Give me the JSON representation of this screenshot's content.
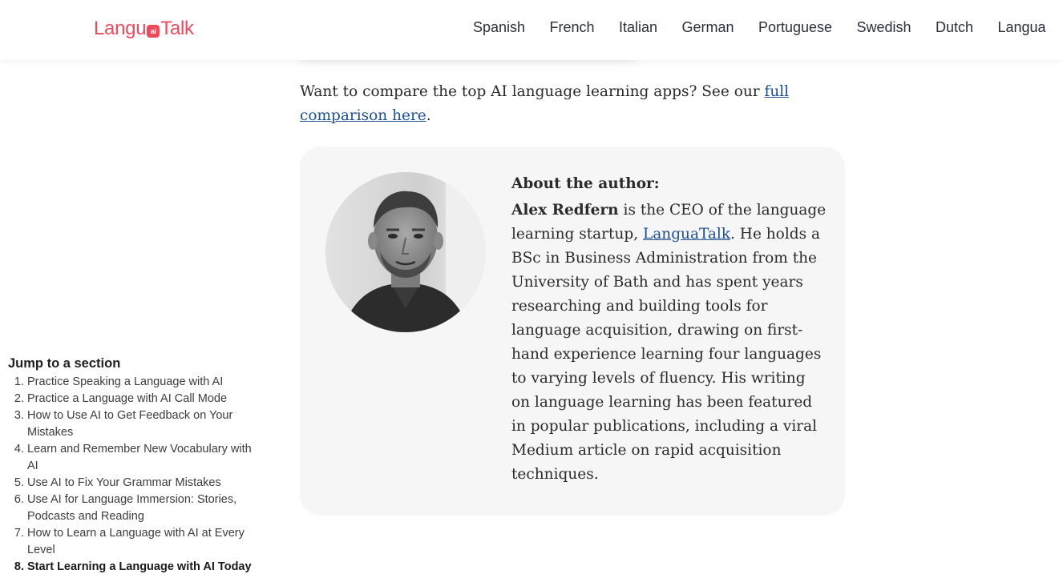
{
  "header": {
    "logo_left": "Langu",
    "logo_badge": "ai",
    "logo_right": "Talk",
    "nav": [
      {
        "label": "Spanish"
      },
      {
        "label": "French"
      },
      {
        "label": "Italian"
      },
      {
        "label": "German"
      },
      {
        "label": "Portuguese"
      },
      {
        "label": "Swedish"
      },
      {
        "label": "Dutch"
      },
      {
        "label": "Langua"
      }
    ]
  },
  "article": {
    "compare_text": "Want to compare the top AI language learning apps? See our ",
    "compare_link": "full comparison here",
    "compare_end": "."
  },
  "author": {
    "heading": "About the author:",
    "name": "Alex Redfern",
    "bio_part1": " is the CEO of the language learning startup, ",
    "company_link": "LanguaTalk",
    "bio_part2": ". He holds a BSc in Business Administration from the University of Bath and has spent years researching and building tools for language acquisition, drawing on first-hand experience learning four languages to varying levels of fluency. His writing on language learning has been featured in popular publications, including a viral Medium article on rapid acquisition techniques."
  },
  "toc": {
    "title": "Jump to a section",
    "items": [
      {
        "label": "Practice Speaking a Language with AI"
      },
      {
        "label": "Practice a Language with AI Call Mode"
      },
      {
        "label": "How to Use AI to Get Feedback on Your Mistakes"
      },
      {
        "label": "Learn and Remember New Vocabulary with AI"
      },
      {
        "label": "Use AI to Fix Your Grammar Mistakes"
      },
      {
        "label": "Use AI for Language Immersion: Stories, Podcasts and Reading"
      },
      {
        "label": "How to Learn a Language with AI at Every Level"
      },
      {
        "label": "Start Learning a Language with AI Today"
      }
    ],
    "active_index": 7
  },
  "colors": {
    "brand": "#ec4a5b",
    "link": "#1d4f91",
    "card_bg": "#f6f6f6"
  }
}
